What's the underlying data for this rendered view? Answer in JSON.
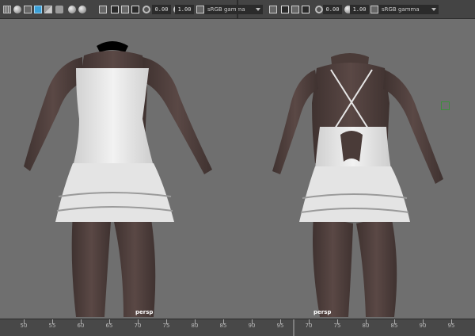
{
  "toolbar": {
    "left": {
      "exposure": "0.00",
      "gamma": "1.00",
      "color_space": "sRGB gamma"
    },
    "right": {
      "exposure": "0.00",
      "gamma": "1.00",
      "color_space": "sRGB gamma"
    }
  },
  "viewport": {
    "left_camera": "persp",
    "right_camera": "persp",
    "colors": {
      "background": "#6f6f6f",
      "skin": "#4e3e3b",
      "dress": "#e8e8e8"
    }
  },
  "timeline": {
    "ticks": [
      "50",
      "55",
      "60",
      "65",
      "70",
      "75",
      "80",
      "85",
      "90",
      "95",
      "70",
      "75",
      "80",
      "85",
      "90",
      "95"
    ]
  }
}
